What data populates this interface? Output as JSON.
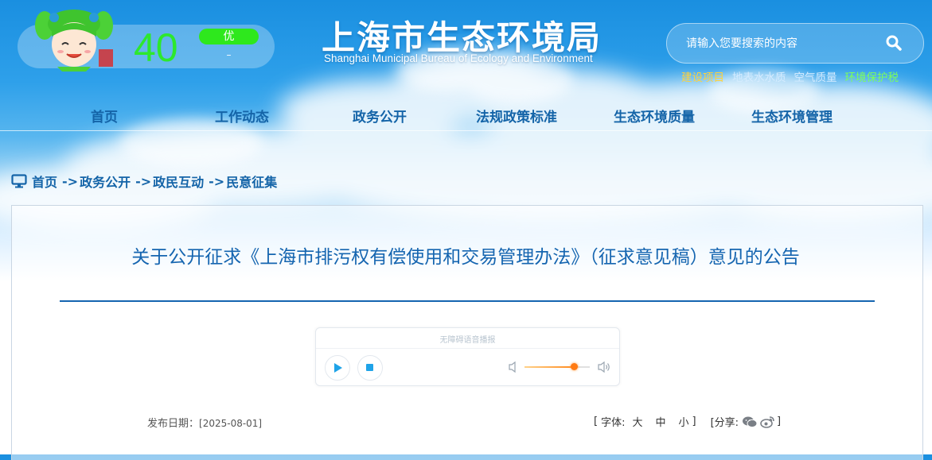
{
  "aqi": {
    "value": "40",
    "level": "优",
    "sub": "–",
    "level_color": "#2ee81d"
  },
  "site": {
    "title": "上海市生态环境局",
    "subtitle": "Shanghai Municipal Bureau of Ecology and Environment"
  },
  "search": {
    "placeholder": "请输入您要搜索的内容",
    "icon": "search-icon"
  },
  "quick_links": [
    {
      "label": "建设项目",
      "color": "#ffd23c"
    },
    {
      "label": "地表水水质",
      "color": "#cfe9ff"
    },
    {
      "label": "空气质量",
      "color": "#cfe9ff"
    },
    {
      "label": "环境保护税",
      "color": "#7dff5a"
    }
  ],
  "nav": {
    "items": [
      {
        "label": "首页"
      },
      {
        "label": "工作动态"
      },
      {
        "label": "政务公开"
      },
      {
        "label": "法规政策标准"
      },
      {
        "label": "生态环境质量"
      },
      {
        "label": "生态环境管理"
      }
    ]
  },
  "breadcrumb": {
    "items": [
      "首页",
      "政务公开",
      "政民互动",
      "民意征集"
    ],
    "separator": "->"
  },
  "article": {
    "title": "关于公开征求《上海市排污权有偿使用和交易管理办法》（征求意见稿）意见的公告",
    "publish_label": "发布日期：",
    "publish_date": "[2025-08-01]"
  },
  "player": {
    "label": "无障碍语音播报",
    "volume_level": 0.75
  },
  "font_size": {
    "open": "[",
    "label": "字体:",
    "large": "大",
    "medium": "中",
    "small": "小",
    "close": "]"
  },
  "share": {
    "open": "[分享:",
    "close": "]"
  }
}
